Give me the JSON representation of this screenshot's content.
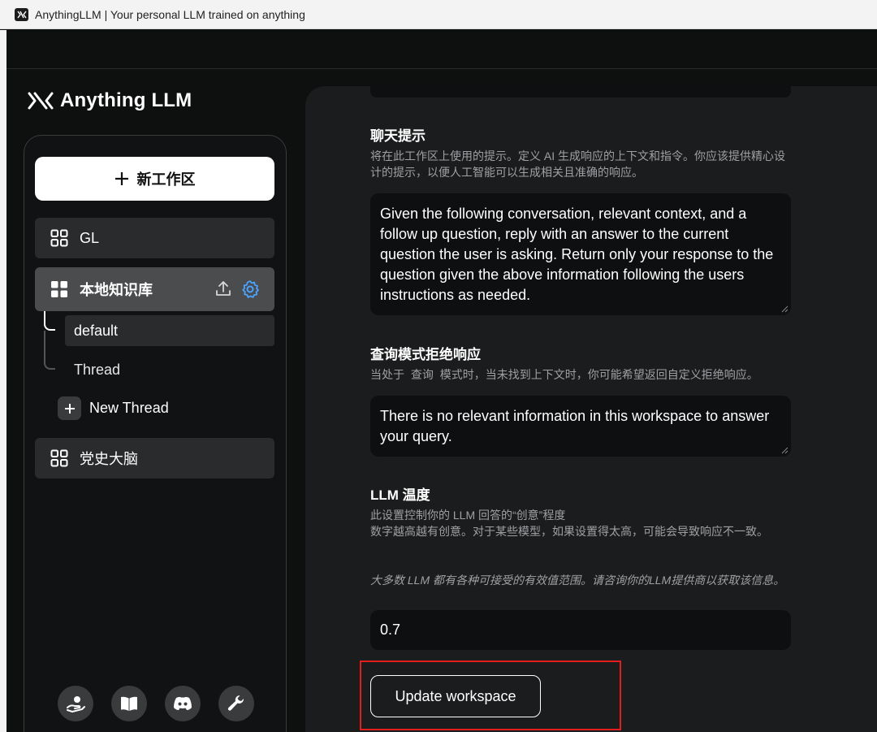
{
  "window": {
    "title": "AnythingLLM | Your personal LLM trained on anything"
  },
  "sidebar": {
    "logo_text": "Anything LLM",
    "new_workspace_label": "新工作区",
    "workspaces": [
      {
        "label": "GL"
      },
      {
        "label": "本地知识库"
      },
      {
        "label": "党史大脑"
      }
    ],
    "threads": [
      {
        "label": "default"
      },
      {
        "label": "Thread"
      }
    ],
    "new_thread_label": "New Thread",
    "footer_icons": [
      "support-icon",
      "docs-book-icon",
      "discord-icon",
      "settings-wrench-icon"
    ]
  },
  "main": {
    "chat_prompt": {
      "title": "聊天提示",
      "description": "将在此工作区上使用的提示。定义 AI 生成响应的上下文和指令。你应该提供精心设计的提示，以便人工智能可以生成相关且准确的响应。",
      "value": "Given the following conversation, relevant context, and a follow up question, reply with an answer to the current question the user is asking. Return only your response to the question given the above information following the users instructions as needed."
    },
    "query_refusal": {
      "title": "查询模式拒绝响应",
      "description_before": "当处于",
      "description_code": "查询",
      "description_after": "模式时，当未找到上下文时，你可能希望返回自定义拒绝响应。",
      "value": "There is no relevant information in this workspace to answer your query."
    },
    "llm_temp": {
      "title": "LLM 温度",
      "description_line1": "此设置控制你的 LLM 回答的“创意”程度",
      "description_line2": "数字越高越有创意。对于某些模型，如果设置得太高，可能会导致响应不一致。",
      "note": "大多数 LLM 都有各种可接受的有效值范围。请咨询你的LLM提供商以获取该信息。",
      "value": "0.7"
    },
    "update_button_label": "Update workspace"
  },
  "colors": {
    "background": "#0e0f0f",
    "panel": "#1b1c1d",
    "input_bg": "#0e0f10",
    "accent_blue": "#4aa3ff",
    "highlight_red": "#e21d1d"
  }
}
